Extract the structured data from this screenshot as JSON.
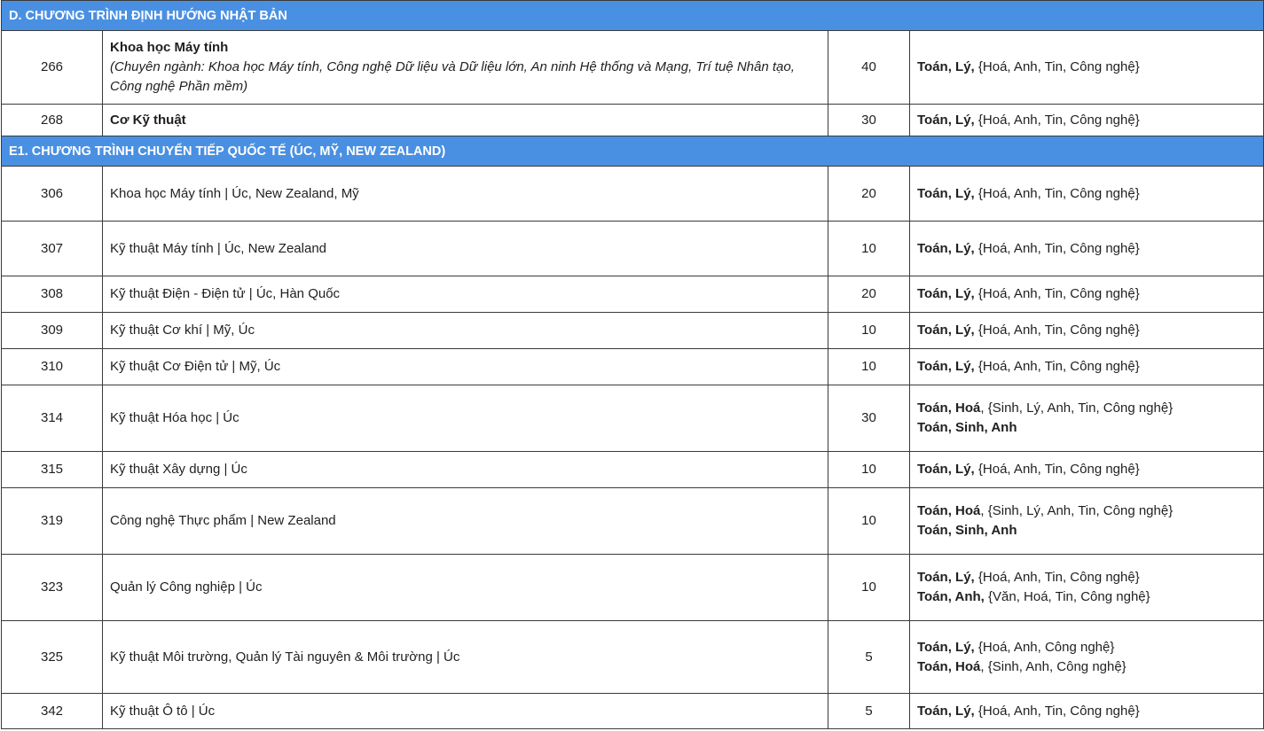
{
  "sections": [
    {
      "title": "D. CHƯƠNG TRÌNH ĐỊNH HƯỚNG NHẬT BẢN",
      "rows": [
        {
          "code": "266",
          "name": "Khoa học Máy tính",
          "note": "(Chuyên ngành: Khoa học Máy tính, Công nghệ Dữ liệu và Dữ liệu lớn, An ninh Hệ thống và Mạng, Trí tuệ Nhân tạo, Công nghệ Phần mềm)",
          "quota": "40",
          "combos": [
            {
              "bold": "Toán, Lý,",
              "rest": " {Hoá, Anh, Tin, Công nghệ}"
            }
          ]
        },
        {
          "code": "268",
          "name": "Cơ Kỹ thuật",
          "quota": "30",
          "combos": [
            {
              "bold": "Toán, Lý,",
              "rest": " {Hoá, Anh, Tin, Công nghệ}"
            }
          ]
        }
      ]
    },
    {
      "title": "E1. CHƯƠNG TRÌNH CHUYỂN TIẾP QUỐC TẾ (ÚC, MỸ, NEW ZEALAND)",
      "rows": [
        {
          "code": "306",
          "name": "Khoa học Máy tính | Úc, New Zealand, Mỹ",
          "quota": "20",
          "combos": [
            {
              "bold": "Toán, Lý,",
              "rest": " {Hoá, Anh, Tin, Công nghệ}"
            }
          ]
        },
        {
          "code": "307",
          "name": "Kỹ thuật Máy tính | Úc, New Zealand",
          "quota": "10",
          "combos": [
            {
              "bold": "Toán, Lý,",
              "rest": " {Hoá, Anh, Tin, Công nghệ}"
            }
          ]
        },
        {
          "code": "308",
          "name": "Kỹ thuật Điện - Điện tử | Úc, Hàn Quốc",
          "quota": "20",
          "combos": [
            {
              "bold": "Toán, Lý,",
              "rest": " {Hoá, Anh, Tin, Công nghệ}"
            }
          ]
        },
        {
          "code": "309",
          "name": "Kỹ thuật Cơ khí | Mỹ, Úc",
          "quota": "10",
          "combos": [
            {
              "bold": "Toán, Lý,",
              "rest": " {Hoá, Anh, Tin, Công nghệ}"
            }
          ]
        },
        {
          "code": "310",
          "name": "Kỹ thuật Cơ Điện tử | Mỹ, Úc",
          "quota": "10",
          "combos": [
            {
              "bold": "Toán, Lý,",
              "rest": " {Hoá, Anh, Tin, Công nghệ}"
            }
          ]
        },
        {
          "code": "314",
          "name": "Kỹ thuật Hóa học | Úc",
          "quota": "30",
          "combos": [
            {
              "bold": "Toán, Hoá",
              "rest": ", {Sinh, Lý, Anh, Tin, Công nghệ}"
            },
            {
              "bold": "Toán, Sinh, Anh",
              "rest": ""
            }
          ]
        },
        {
          "code": "315",
          "name": "Kỹ thuật Xây dựng | Úc",
          "quota": "10",
          "combos": [
            {
              "bold": "Toán, Lý,",
              "rest": " {Hoá, Anh, Tin, Công nghệ}"
            }
          ]
        },
        {
          "code": "319",
          "name": "Công nghệ Thực phẩm | New Zealand",
          "quota": "10",
          "combos": [
            {
              "bold": "Toán, Hoá",
              "rest": ", {Sinh, Lý, Anh, Tin, Công nghệ}"
            },
            {
              "bold": "Toán, Sinh, Anh",
              "rest": ""
            }
          ]
        },
        {
          "code": "323",
          "name": "Quản lý Công nghiệp | Úc",
          "quota": "10",
          "combos": [
            {
              "bold": "Toán, Lý,",
              "rest": " {Hoá, Anh, Tin, Công nghệ}"
            },
            {
              "bold": "Toán, Anh,",
              "rest": " {Văn, Hoá, Tin, Công nghệ}"
            }
          ]
        },
        {
          "code": "325",
          "name": "Kỹ thuật Môi trường, Quản lý Tài nguyên & Môi trường | Úc",
          "quota": "5",
          "combos": [
            {
              "bold": "Toán, Lý,",
              "rest": " {Hoá, Anh, Công nghệ}"
            },
            {
              "bold": "Toán, Hoá",
              "rest": ", {Sinh, Anh, Công nghệ}"
            }
          ]
        },
        {
          "code": "342",
          "name": "Kỹ thuật Ô tô | Úc",
          "quota": "5",
          "combos": [
            {
              "bold": "Toán, Lý,",
              "rest": " {Hoá, Anh, Tin, Công nghệ}"
            }
          ]
        }
      ]
    }
  ],
  "colors": {
    "section_header_bg": "#4a90e2",
    "section_header_text": "#ffffff",
    "border": "#3a3a3a"
  }
}
